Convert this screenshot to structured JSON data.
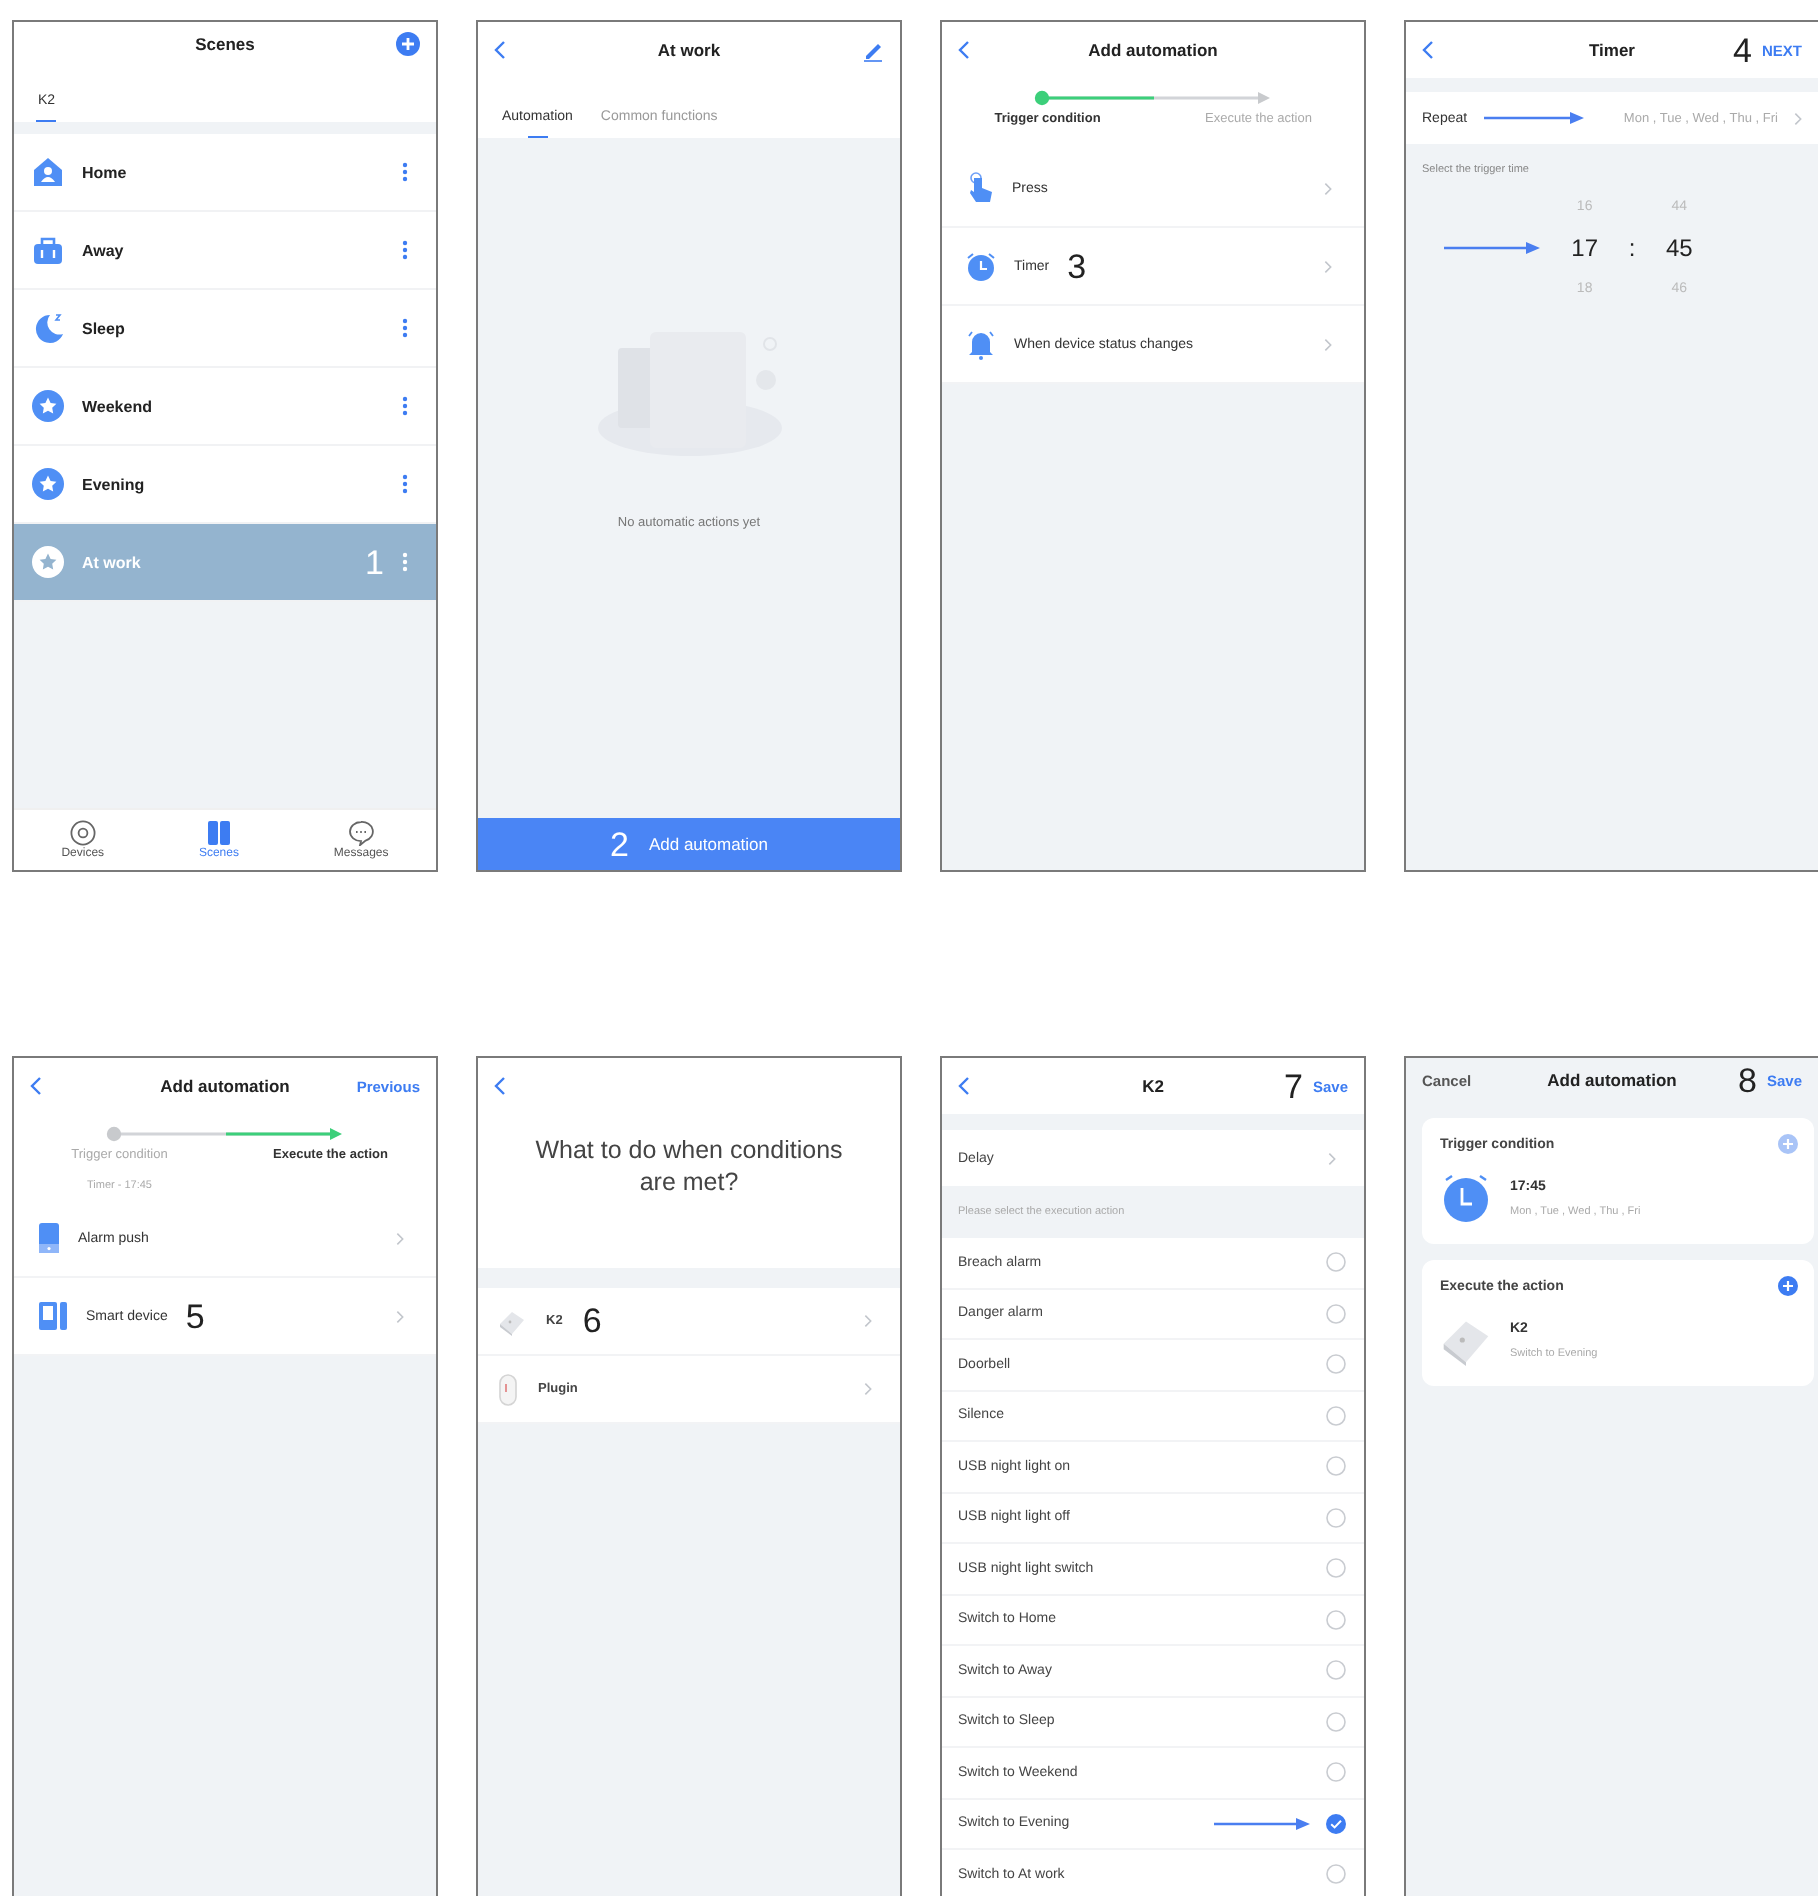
{
  "screens": [
    {
      "kind": "scenes",
      "header": {
        "title": "Scenes",
        "right": {
          "kind": "add"
        }
      },
      "tabs": [
        {
          "label": "K2",
          "selected": true
        }
      ],
      "items": [
        {
          "kind": "home",
          "name": "Home",
          "selected": false
        },
        {
          "kind": "away",
          "name": "Away",
          "selected": false
        },
        {
          "kind": "sleep",
          "name": "Sleep",
          "selected": false
        },
        {
          "kind": "star",
          "name": "Weekend",
          "selected": false
        },
        {
          "kind": "star",
          "name": "Evening",
          "selected": false
        },
        {
          "kind": "star",
          "name": "At work",
          "selected": true,
          "step": "1"
        }
      ],
      "nav": [
        {
          "kind": "devices",
          "label": "Devices",
          "selected": false
        },
        {
          "kind": "scenes",
          "label": "Scenes",
          "selected": true
        },
        {
          "kind": "messages",
          "label": "Messages",
          "selected": false
        }
      ]
    },
    {
      "kind": "scene_detail",
      "header": {
        "title": "At work",
        "left": {
          "kind": "back"
        },
        "right": {
          "kind": "edit"
        }
      },
      "tabs": [
        {
          "label": "Automation",
          "selected": true
        },
        {
          "label": "Common functions",
          "selected": false
        }
      ],
      "empty_text": "No automatic actions yet",
      "button": {
        "label": "Add automation",
        "step": "2"
      }
    },
    {
      "kind": "wizard",
      "header": {
        "title": "Add automation",
        "left": {
          "kind": "back"
        }
      },
      "progress": [
        {
          "label": "Trigger condition",
          "selected": true
        },
        {
          "label": "Execute the action",
          "selected": false
        }
      ],
      "options": [
        {
          "kind": "press",
          "label": "Press"
        },
        {
          "kind": "timer",
          "label": "Timer",
          "step": "3"
        },
        {
          "kind": "status",
          "label": "When device status changes"
        }
      ]
    },
    {
      "kind": "timer",
      "header": {
        "title": "Timer",
        "left": {
          "kind": "back"
        },
        "step": "4",
        "right": {
          "kind": "text",
          "label": "NEXT"
        }
      },
      "repeat": {
        "label": "Repeat",
        "value": "Mon , Tue , Wed , Thu , Fri",
        "arrow": true
      },
      "hint": "Select the trigger time",
      "picker": {
        "arrow": true,
        "separator": ":",
        "hours": [
          {
            "value": "16",
            "selected": false
          },
          {
            "value": "17",
            "selected": true
          },
          {
            "value": "18",
            "selected": false
          }
        ],
        "minutes": [
          {
            "value": "44",
            "selected": false
          },
          {
            "value": "45",
            "selected": true
          },
          {
            "value": "46",
            "selected": false
          }
        ]
      }
    },
    {
      "kind": "wizard",
      "header": {
        "title": "Add automation",
        "left": {
          "kind": "back"
        },
        "right": {
          "kind": "text",
          "label": "Previous"
        }
      },
      "progress": [
        {
          "label": "Trigger condition",
          "selected": false,
          "note": "Timer - 17:45"
        },
        {
          "label": "Execute the action",
          "selected": true
        }
      ],
      "options": [
        {
          "kind": "phone",
          "label": "Alarm push"
        },
        {
          "kind": "device",
          "label": "Smart device",
          "step": "5"
        }
      ]
    },
    {
      "kind": "devices",
      "header": {
        "left": {
          "kind": "back"
        }
      },
      "question": "What to do when conditions are met?",
      "devices": [
        {
          "kind": "hub",
          "name": "K2",
          "step": "6"
        },
        {
          "kind": "plug",
          "name": "Plugin"
        }
      ]
    },
    {
      "kind": "actions",
      "header": {
        "title": "K2",
        "left": {
          "kind": "back"
        },
        "step": "7",
        "right": {
          "kind": "text",
          "label": "Save"
        }
      },
      "delay": "Delay",
      "hint": "Please select the execution action",
      "actions": [
        {
          "label": "Breach alarm",
          "checked": false,
          "arrow": false
        },
        {
          "label": "Danger alarm",
          "checked": false,
          "arrow": false
        },
        {
          "label": "Doorbell",
          "checked": false,
          "arrow": false
        },
        {
          "label": "Silence",
          "checked": false,
          "arrow": false
        },
        {
          "label": "USB night light on",
          "checked": false,
          "arrow": false
        },
        {
          "label": "USB night light off",
          "checked": false,
          "arrow": false
        },
        {
          "label": "USB night light switch",
          "checked": false,
          "arrow": false
        },
        {
          "label": "Switch to Home",
          "checked": false,
          "arrow": false
        },
        {
          "label": "Switch to Away",
          "checked": false,
          "arrow": false
        },
        {
          "label": "Switch to Sleep",
          "checked": false,
          "arrow": false
        },
        {
          "label": "Switch to Weekend",
          "checked": false,
          "arrow": false
        },
        {
          "label": "Switch to Evening",
          "checked": true,
          "arrow": true
        },
        {
          "label": "Switch to At work",
          "checked": false,
          "arrow": false
        }
      ]
    },
    {
      "kind": "summary",
      "header": {
        "title": "Add automation",
        "left": {
          "kind": "cancel",
          "label": "Cancel"
        },
        "step": "8",
        "right": {
          "kind": "text",
          "label": "Save"
        }
      },
      "sections": [
        {
          "title": "Trigger condition",
          "add_enabled": false,
          "entry": {
            "kind": "timer",
            "title": "17:45",
            "subtitle": "Mon , Tue , Wed , Thu , Fri"
          }
        },
        {
          "title": "Execute the action",
          "add_enabled": true,
          "entry": {
            "kind": "hub",
            "title": "K2",
            "subtitle": "Switch to Evening"
          }
        }
      ]
    }
  ]
}
